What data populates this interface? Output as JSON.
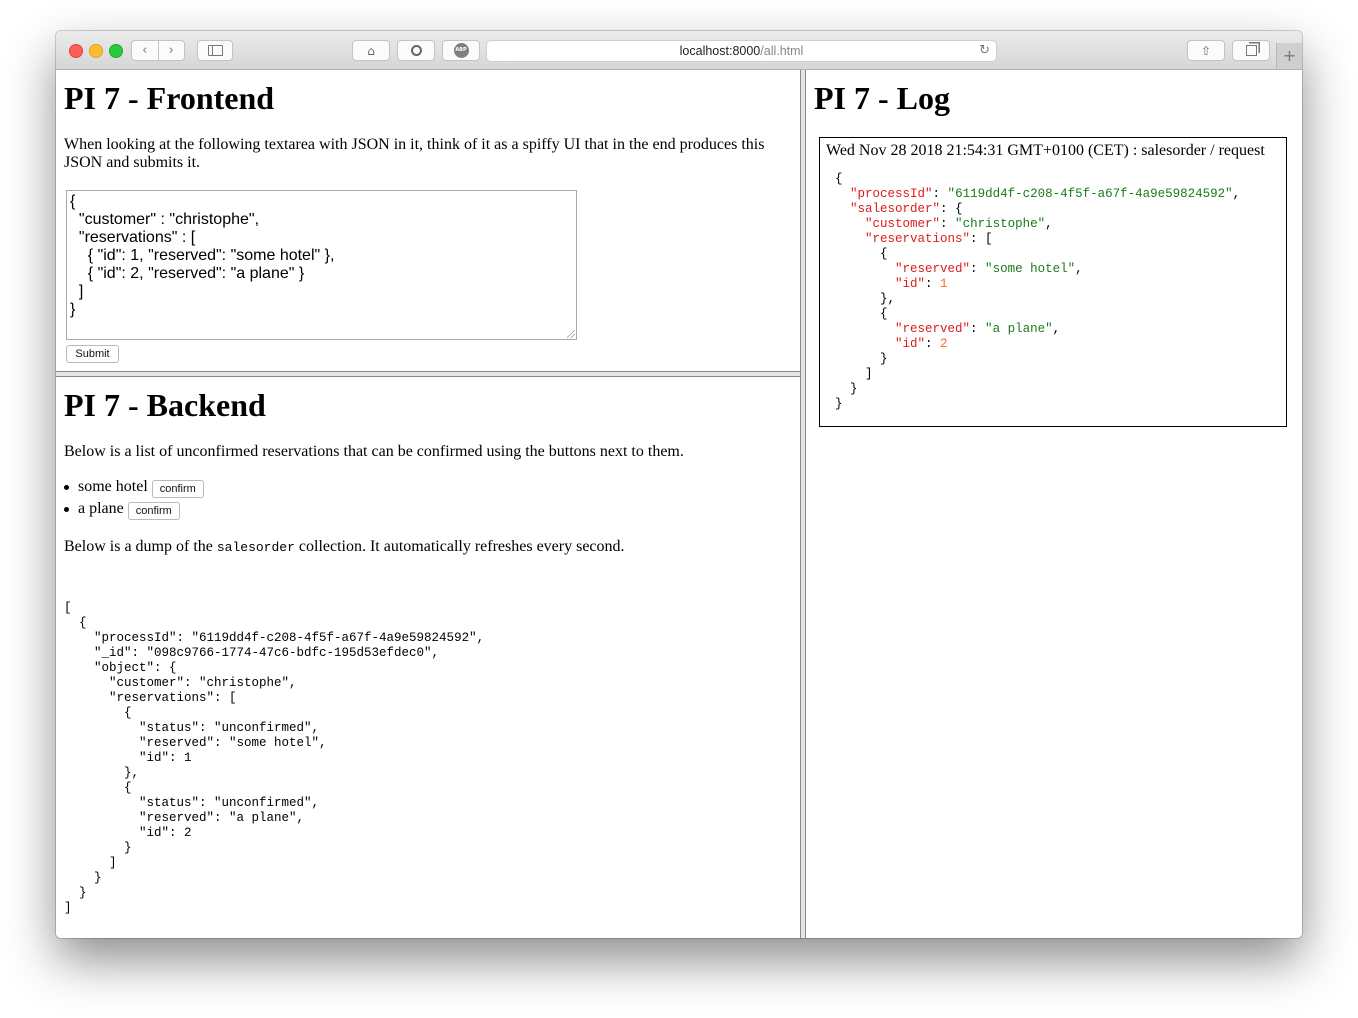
{
  "browser": {
    "url_host": "localhost:8000",
    "url_path": "/all.html",
    "icons": [
      "back-icon",
      "forward-icon",
      "sidebar-icon",
      "home-icon",
      "history-icon",
      "adblock-icon",
      "reload-icon",
      "share-icon",
      "tabs-icon",
      "new-tab-icon"
    ],
    "adblock_label": "ABP",
    "new_tab_label": "+"
  },
  "frontend": {
    "title": "PI 7 - Frontend",
    "description": "When looking at the following textarea with JSON in it, think of it as a spiffy UI that in the end produces this JSON and submits it.",
    "textarea_value": "{\n  \"customer\" : \"christophe\",\n  \"reservations\" : [\n    { \"id\": 1, \"reserved\": \"some hotel\" },\n    { \"id\": 2, \"reserved\": \"a plane\" }\n  ]\n}",
    "submit_label": "Submit"
  },
  "backend": {
    "title": "PI 7 - Backend",
    "description": "Below is a list of unconfirmed reservations that can be confirmed using the buttons next to them.",
    "reservations": [
      {
        "label": "some hotel",
        "button": "confirm"
      },
      {
        "label": "a plane",
        "button": "confirm"
      }
    ],
    "dump_intro_before": "Below is a dump of the ",
    "dump_intro_code": "salesorder",
    "dump_intro_after": " collection. It automatically refreshes every second.",
    "dump": "[\n  {\n    \"processId\": \"6119dd4f-c208-4f5f-a67f-4a9e59824592\",\n    \"_id\": \"098c9766-1774-47c6-bdfc-195d53efdec0\",\n    \"object\": {\n      \"customer\": \"christophe\",\n      \"reservations\": [\n        {\n          \"status\": \"unconfirmed\",\n          \"reserved\": \"some hotel\",\n          \"id\": 1\n        },\n        {\n          \"status\": \"unconfirmed\",\n          \"reserved\": \"a plane\",\n          \"id\": 2\n        }\n      ]\n    }\n  }\n]"
  },
  "log": {
    "title": "PI 7 - Log",
    "entry_header": "Wed Nov 28 2018 21:54:31 GMT+0100 (CET) : salesorder / request",
    "process_id": "6119dd4f-c208-4f5f-a67f-4a9e59824592",
    "customer": "christophe",
    "reservations": [
      {
        "reserved": "some hotel",
        "id": "1"
      },
      {
        "reserved": "a plane",
        "id": "2"
      }
    ]
  }
}
